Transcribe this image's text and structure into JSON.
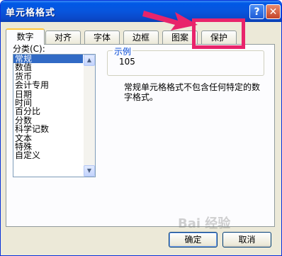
{
  "window": {
    "title": "单元格格式",
    "help_label": "?",
    "close_label": "✕"
  },
  "tabs": [
    {
      "label": "数字"
    },
    {
      "label": "对齐"
    },
    {
      "label": "字体"
    },
    {
      "label": "边框"
    },
    {
      "label": "图案"
    },
    {
      "label": "保护"
    }
  ],
  "category": {
    "label": "分类(C):",
    "items": [
      "常规",
      "数值",
      "货币",
      "会计专用",
      "日期",
      "时间",
      "百分比",
      "分数",
      "科学记数",
      "文本",
      "特殊",
      "自定义"
    ],
    "selected": "常规"
  },
  "sample": {
    "legend": "示例",
    "value": "105"
  },
  "description": "常规单元格格式不包含任何特定的数字格式。",
  "buttons": {
    "ok": "确定",
    "cancel": "取消"
  },
  "colors": {
    "highlight": "#e8246b",
    "titlebar": "#0855dd",
    "selection": "#316ac5"
  },
  "watermark": "Bai 经验"
}
